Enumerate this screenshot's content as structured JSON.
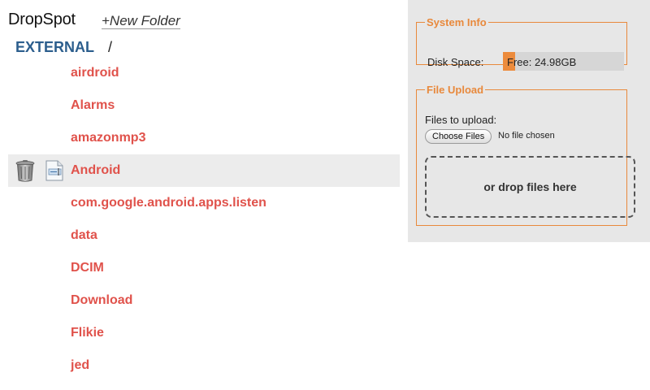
{
  "app": {
    "title": "DropSpot",
    "new_folder_label": "+New Folder"
  },
  "breadcrumb": {
    "root": "EXTERNAL",
    "separator": "/"
  },
  "files": [
    {
      "name": "airdroid"
    },
    {
      "name": "Alarms"
    },
    {
      "name": "amazonmp3"
    },
    {
      "name": "Android",
      "selected": true
    },
    {
      "name": "com.google.android.apps.listen"
    },
    {
      "name": "data"
    },
    {
      "name": "DCIM"
    },
    {
      "name": "Download"
    },
    {
      "name": "Flikie"
    },
    {
      "name": "jed"
    }
  ],
  "system_info": {
    "legend": "System Info",
    "disk_label": "Disk Space:",
    "disk_free_text": "Free: 24.98GB",
    "disk_used_fraction": 0.1
  },
  "file_upload": {
    "legend": "File Upload",
    "files_label": "Files to upload:",
    "choose_button": "Choose Files",
    "no_file_text": "No file chosen",
    "drop_text": "or drop files here"
  },
  "colors": {
    "accent": "#e8893c",
    "file_link": "#e0524b",
    "breadcrumb_root": "#2c5e8d",
    "selected_row": "#ececec",
    "panel_bg": "#e7e7e7"
  },
  "icons": {
    "delete": "trash-icon",
    "rename": "rename-icon"
  }
}
